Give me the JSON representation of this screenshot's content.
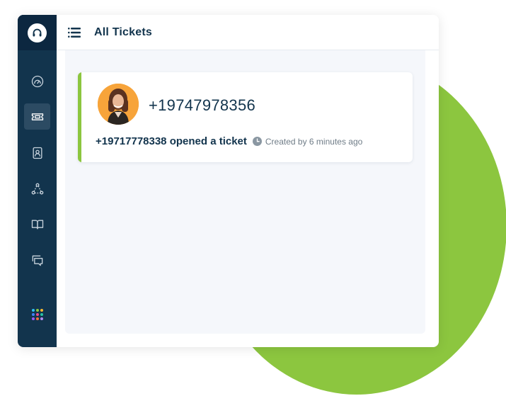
{
  "colors": {
    "sidebar": "#12344d",
    "sidebar_logo_bg": "#0c2740",
    "accent_green": "#8cc63f",
    "content_bg": "#f5f7fb",
    "text_dark": "#12344d",
    "text_muted": "#6f7c87"
  },
  "sidebar": {
    "logo_icon": "headset-icon",
    "items": [
      {
        "icon": "dashboard-gauge-icon",
        "active": false
      },
      {
        "icon": "ticket-icon",
        "active": true
      },
      {
        "icon": "contact-card-icon",
        "active": false
      },
      {
        "icon": "groups-network-icon",
        "active": false
      },
      {
        "icon": "solutions-book-icon",
        "active": false
      },
      {
        "icon": "chat-bubbles-icon",
        "active": false
      }
    ],
    "apps_icon": "apps-grid-icon"
  },
  "header": {
    "menu_icon": "hamburger-menu-icon",
    "title": "All Tickets"
  },
  "tickets": [
    {
      "requester": "+19747978356",
      "subject": "+19717778338 opened a ticket",
      "created": "Created by 6 minutes ago",
      "status_color": "#8cc63f"
    }
  ]
}
